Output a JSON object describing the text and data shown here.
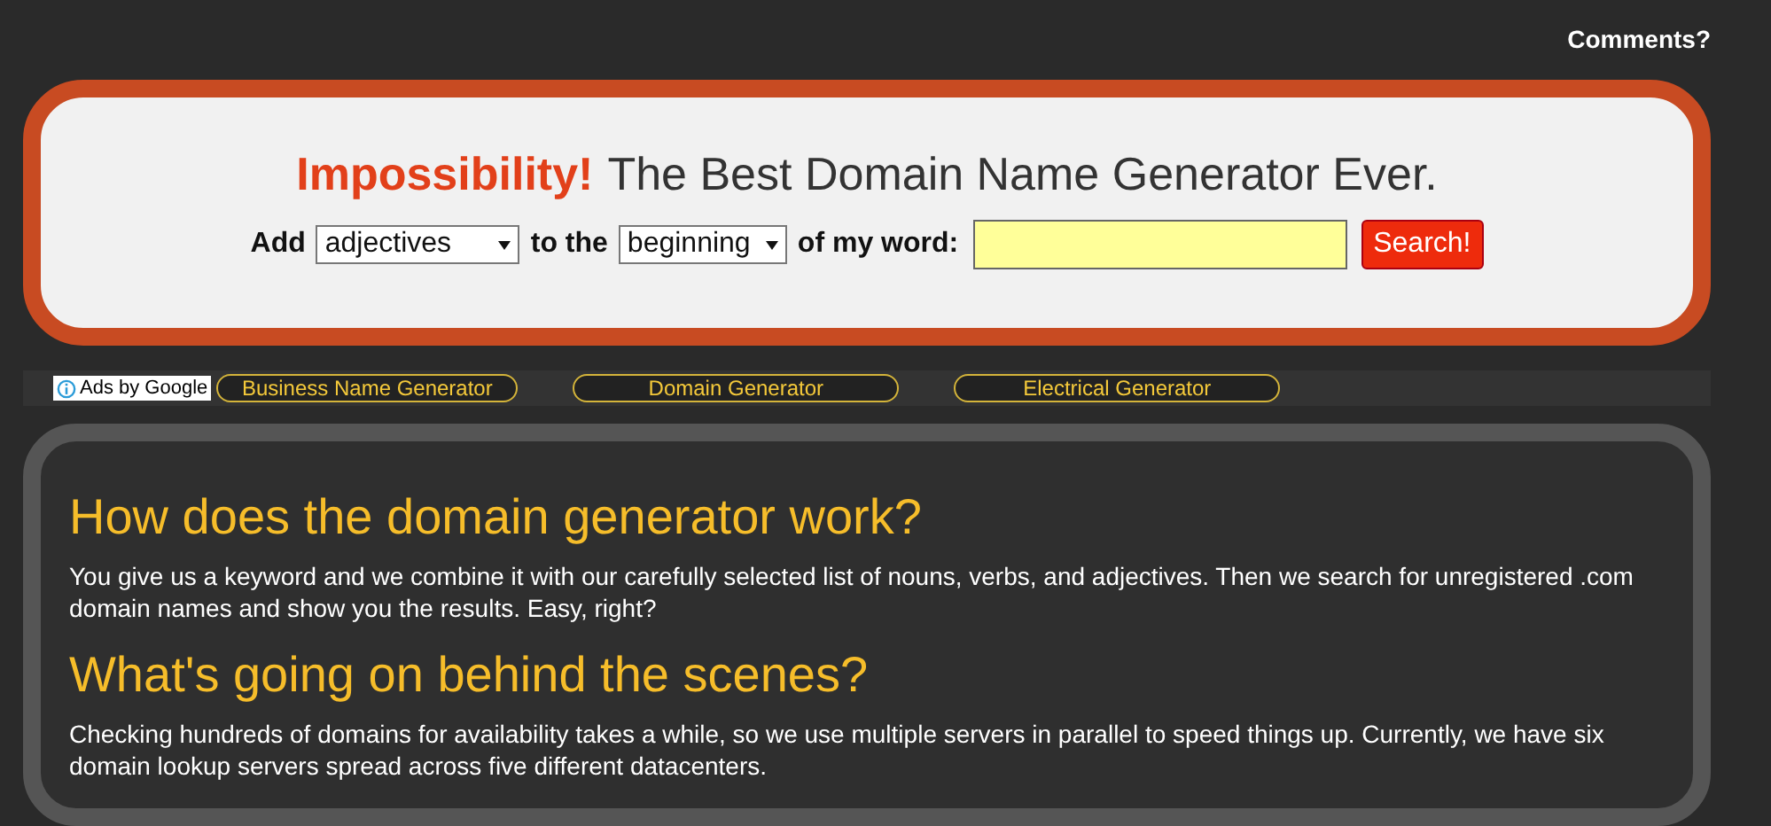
{
  "top_link": "Comments?",
  "header": {
    "brand": "Impossibility!",
    "tagline": "The Best Domain Name Generator Ever.",
    "form": {
      "label_1": "Add",
      "select_1": "adjectives",
      "label_2": "to the",
      "select_2": "beginning",
      "label_3": "of my word:",
      "search_button": "Search!"
    }
  },
  "ad_bar": {
    "badge": "Ads by Google",
    "links": [
      "Business Name Generator",
      "Domain Generator",
      "Electrical Generator"
    ]
  },
  "sections": [
    {
      "heading": "How does the domain generator work?",
      "text": "You give us a keyword and we combine it with our carefully selected list of nouns, verbs, and adjectives. Then we search for unregistered .com domain names and show you the results. Easy, right?"
    },
    {
      "heading": "What's going on behind the scenes?",
      "text": "Checking hundreds of domains for availability takes a while, so we use multiple servers in parallel to speed things up. Currently, we have six domain lookup servers spread across five different datacenters."
    }
  ]
}
